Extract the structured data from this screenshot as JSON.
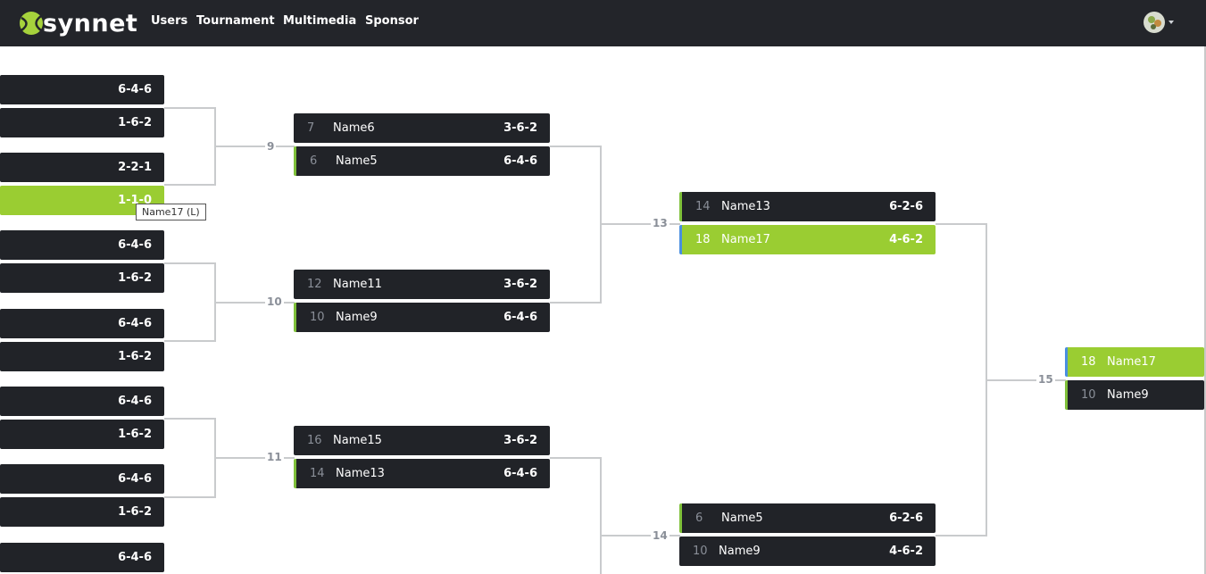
{
  "nav": {
    "logo_text": "synnet",
    "links": [
      "Users",
      "Tournament",
      "Multimedia",
      "Sponsor"
    ]
  },
  "bracket": {
    "round1_scores": [
      "6-4-6",
      "1-6-2",
      "2-2-1",
      "1-1-0",
      "6-4-6",
      "1-6-2",
      "6-4-6",
      "1-6-2",
      "6-4-6",
      "1-6-2",
      "6-4-6",
      "1-6-2",
      "6-4-6"
    ],
    "round2": [
      {
        "label": "9",
        "top": {
          "seed": "7",
          "name": "Name6",
          "score": "3-6-2"
        },
        "bottom": {
          "seed": "6",
          "name": "Name5",
          "score": "6-4-6"
        }
      },
      {
        "label": "10",
        "top": {
          "seed": "12",
          "name": "Name11",
          "score": "3-6-2"
        },
        "bottom": {
          "seed": "10",
          "name": "Name9",
          "score": "6-4-6"
        }
      },
      {
        "label": "11",
        "top": {
          "seed": "16",
          "name": "Name15",
          "score": "3-6-2"
        },
        "bottom": {
          "seed": "14",
          "name": "Name13",
          "score": "6-4-6"
        }
      }
    ],
    "round3": [
      {
        "label": "13",
        "top": {
          "seed": "14",
          "name": "Name13",
          "score": "6-2-6"
        },
        "bottom": {
          "seed": "18",
          "name": "Name17",
          "score": "4-6-2"
        }
      },
      {
        "label": "14",
        "top": {
          "seed": "6",
          "name": "Name5",
          "score": "6-2-6"
        },
        "bottom": {
          "seed": "10",
          "name": "Name9",
          "score": "4-6-2"
        }
      }
    ],
    "final": {
      "label": "15",
      "top": {
        "seed": "18",
        "name": "Name17"
      },
      "bottom": {
        "seed": "10",
        "name": "Name9"
      }
    },
    "tooltip": "Name17 (L)"
  },
  "colors": {
    "navbar": "#23252a",
    "slot": "#212328",
    "winner": "#9acd32",
    "connector": "#c9cbcd"
  }
}
